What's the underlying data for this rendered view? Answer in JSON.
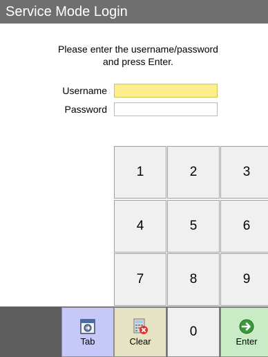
{
  "window": {
    "title": "Service Mode Login"
  },
  "instructions": {
    "line1": "Please enter the username/password",
    "line2": "and press Enter."
  },
  "form": {
    "username_label": "Username",
    "username_value": "",
    "password_label": "Password",
    "password_value": ""
  },
  "keypad": {
    "keys": [
      "1",
      "2",
      "3",
      "4",
      "5",
      "6",
      "7",
      "8",
      "9",
      "0"
    ]
  },
  "actions": {
    "tab_label": "Tab",
    "clear_label": "Clear",
    "enter_label": "Enter"
  },
  "colors": {
    "titlebar": "#6f6f6f",
    "field_focus": "#fcee8c",
    "tab_key": "#c6c8f8",
    "clear_key": "#e5e3c3",
    "enter_key": "#c9ecc6",
    "enter_icon": "#3a9a3a"
  },
  "icons": {
    "tab": "tab-window-icon",
    "clear": "clear-calculator-icon",
    "enter": "arrow-right-circle-icon"
  }
}
